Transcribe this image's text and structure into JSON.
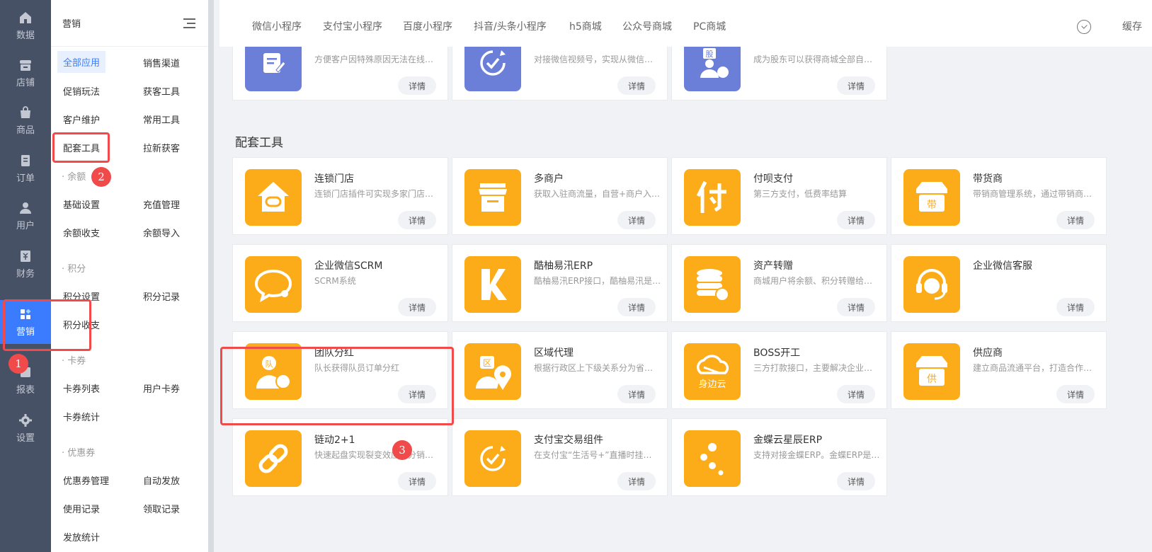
{
  "rail": [
    {
      "label": "数据",
      "icon": "home-icon"
    },
    {
      "label": "店铺",
      "icon": "store-icon"
    },
    {
      "label": "商品",
      "icon": "bag-icon"
    },
    {
      "label": "订单",
      "icon": "order-icon"
    },
    {
      "label": "用户",
      "icon": "user-icon"
    },
    {
      "label": "财务",
      "icon": "finance-icon"
    },
    {
      "label": "营销",
      "icon": "apps-icon",
      "active": true
    },
    {
      "label": "报表",
      "icon": "report-icon"
    },
    {
      "label": "设置",
      "icon": "gear-icon"
    }
  ],
  "submenu": {
    "title": "营销",
    "items": {
      "all_apps": "全部应用",
      "sales_channel": "销售渠道",
      "promo": "促销玩法",
      "acquire": "获客工具",
      "retention": "客户维护",
      "common_tools": "常用工具",
      "supporting_tools": "配套工具",
      "new_customers": "拉新获客",
      "balance_group": "· 余额",
      "basic_settings": "基础设置",
      "recharge": "充值管理",
      "balance_flow": "余额收支",
      "balance_import": "余额导入",
      "points_group": "· 积分",
      "points_settings": "积分设置",
      "points_record": "积分记录",
      "points_flow": "积分收支",
      "card_group": "· 卡券",
      "card_list": "卡券列表",
      "user_card": "用户卡券",
      "card_stats": "卡券统计",
      "coupon_group": "· 优惠券",
      "coupon_mgmt": "优惠券管理",
      "auto_issue": "自动发放",
      "usage_record": "使用记录",
      "claim_record": "领取记录",
      "issue_stats": "发放统计"
    }
  },
  "tabs": [
    "微信小程序",
    "支付宝小程序",
    "百度小程序",
    "抖音/头条小程序",
    "h5商城",
    "公众号商城",
    "PC商城"
  ],
  "cache_label": "缓存",
  "detail_label": "详情",
  "top_cards": [
    {
      "desc": "方便客户因特殊原因无法在线…",
      "icon": "form-icon"
    },
    {
      "desc": "对接微信视频号，实现从微信…",
      "icon": "video-check-icon"
    },
    {
      "desc": "成为股东可以获得商城全部自…",
      "icon": "shareholder-icon"
    }
  ],
  "section_title": "配套工具",
  "cards": [
    {
      "name": "连锁门店",
      "desc": "连锁门店插件可实现多家门店…",
      "icon": "chain-store-icon"
    },
    {
      "name": "多商户",
      "desc": "获取入驻商流量，自营+商户入…",
      "icon": "multi-merchant-icon"
    },
    {
      "name": "付呗支付",
      "desc": "第三方支付，低费率结算",
      "icon": "fubei-pay-icon"
    },
    {
      "name": "带货商",
      "desc": "带销商管理系统，通过带销商…",
      "icon": "seller-icon"
    },
    {
      "name": "企业微信SCRM",
      "desc": "SCRM系统",
      "icon": "chat-bubble-icon"
    },
    {
      "name": "酷柚易汛ERP",
      "desc": "酷柚易汛ERP接口，酷柚易汛是…",
      "icon": "erp-k-icon"
    },
    {
      "name": "资产转赠",
      "desc": "商城用户将余额、积分转赠给…",
      "icon": "coins-transfer-icon"
    },
    {
      "name": "企业微信客服",
      "desc": "",
      "icon": "headset-icon"
    },
    {
      "name": "团队分红",
      "desc": "队长获得队员订单分红",
      "icon": "team-dividend-icon"
    },
    {
      "name": "区域代理",
      "desc": "根据行政区上下级关系分为省…",
      "icon": "region-agent-icon"
    },
    {
      "name": "BOSS开工",
      "desc": "三方打款接口，主要解决企业…",
      "icon": "cloud-icon"
    },
    {
      "name": "供应商",
      "desc": "建立商品流通平台，打造合作…",
      "icon": "supplier-icon"
    },
    {
      "name": "链动2+1",
      "desc": "快速起盘实现裂变效应的分销…",
      "icon": "link-icon"
    },
    {
      "name": "支付宝交易组件",
      "desc": "在支付宝“生活号+”直播时挂…",
      "icon": "alipay-component-icon"
    },
    {
      "name": "金蝶云星辰ERP",
      "desc": "支持对接金蝶ERP。金蝶ERP是…",
      "icon": "dots-icon"
    }
  ],
  "icon_text": {
    "dai": "带",
    "gong": "供",
    "dui": "队",
    "qu": "区",
    "gu": "股",
    "shenbianyun": "身边云"
  },
  "badges": [
    "1",
    "2",
    "3"
  ],
  "colors": {
    "rail_bg": "#475166",
    "active": "#3b7cff",
    "icon_bg": "#fcac19",
    "annotation": "#f04a4a"
  }
}
